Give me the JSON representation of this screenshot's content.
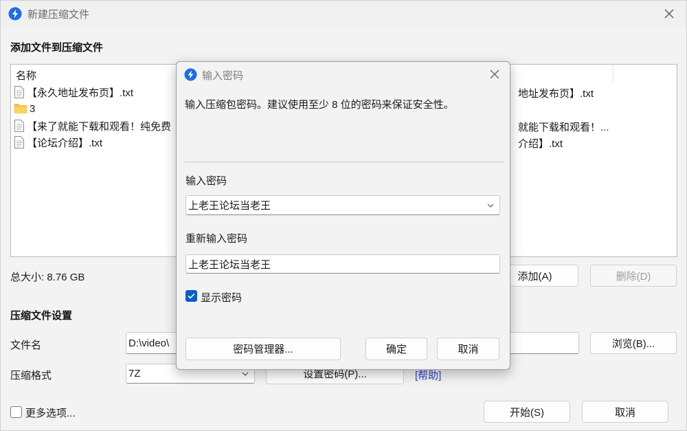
{
  "window": {
    "title": "新建压缩文件",
    "accent": "#1b6fe0"
  },
  "files_section": {
    "title": "添加文件到压缩文件",
    "column_name": "名称",
    "rows": [
      {
        "name": "【永久地址发布页】.txt",
        "icon": "text-file-icon"
      },
      {
        "name": "3",
        "icon": "folder-icon"
      },
      {
        "name": "【来了就能下载和观看！纯免费",
        "icon": "text-file-icon"
      },
      {
        "name": "【论坛介绍】.txt",
        "icon": "text-file-icon"
      }
    ],
    "right_rows": [
      "地址发布页】.txt",
      "",
      "就能下载和观看！...",
      "介绍】.txt"
    ],
    "total_size": "总大小: 8.76 GB",
    "add_button": "添加(A)",
    "delete_button": "删除(D)"
  },
  "archive_settings": {
    "title": "压缩文件设置",
    "filename_label": "文件名",
    "filename_value": "D:\\video\\",
    "browse_button": "浏览(B)...",
    "format_label": "压缩格式",
    "format_value": "7Z",
    "set_password_button": "设置密码(P)...",
    "help_link": "[帮助]"
  },
  "footer": {
    "more_options": "更多选项...",
    "more_options_checked": false,
    "start_button": "开始(S)",
    "cancel_button": "取消"
  },
  "password_dialog": {
    "title": "输入密码",
    "description": "输入压缩包密码。建议使用至少 8 位的密码来保证安全性。",
    "password_label": "输入密码",
    "password_value": "上老王论坛当老王",
    "reenter_label": "重新输入密码",
    "reenter_value": "上老王论坛当老王",
    "show_password_label": "显示密码",
    "show_password_checked": true,
    "manager_button": "密码管理器...",
    "ok_button": "确定",
    "cancel_button": "取消"
  }
}
